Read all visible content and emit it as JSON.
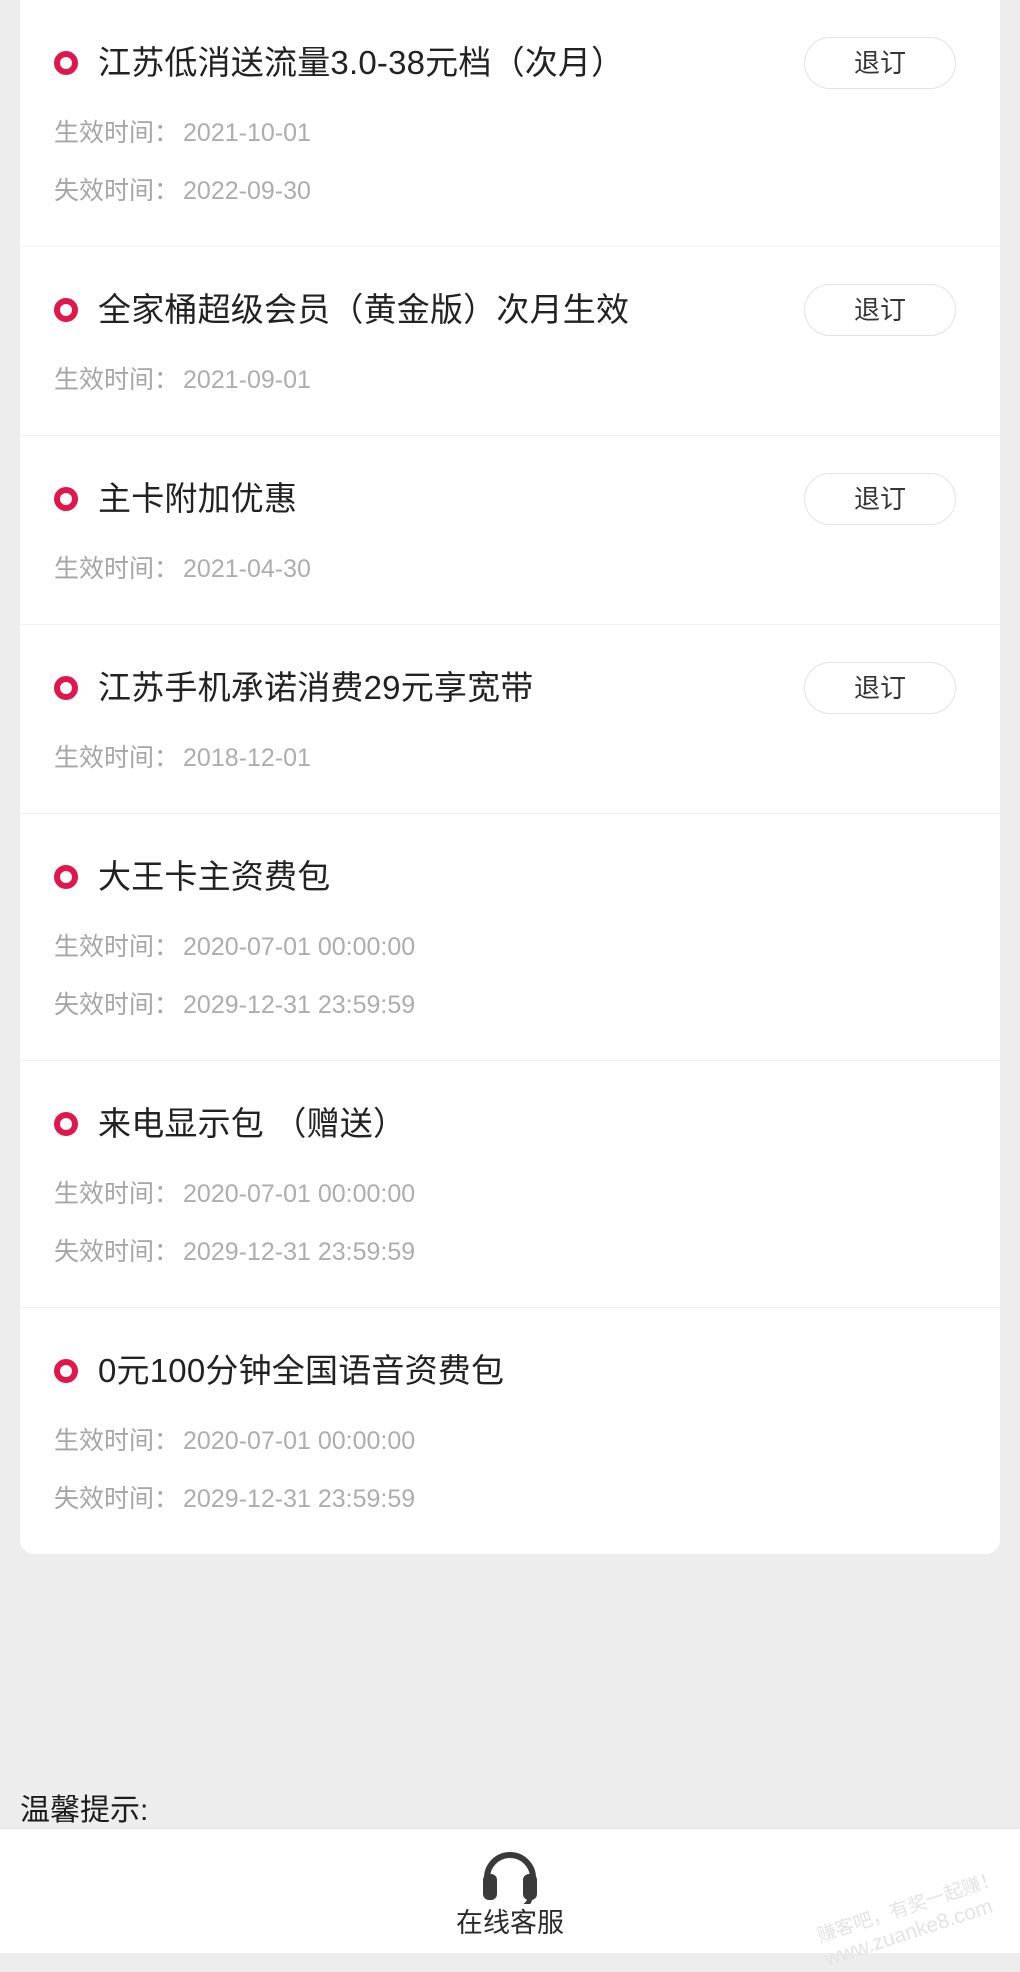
{
  "colors": {
    "page_background": "#ededed",
    "card_background": "#ffffff",
    "bullet_red": "#e1174b",
    "title_text": "#222222",
    "meta_text": "#a6a6a6",
    "button_border": "#e3e3e3"
  },
  "labels": {
    "effective_time": "生效时间：",
    "expiry_time": "失效时间：",
    "unsubscribe": "退订"
  },
  "packages": [
    {
      "name": "江苏低消送流量3.0-38元档（次月）",
      "effective_time": "2021-10-01",
      "expiry_time": "2022-09-30",
      "has_unsubscribe": true,
      "bullet_icon": "red-ring-icon"
    },
    {
      "name": "全家桶超级会员（黄金版）次月生效",
      "effective_time": "2021-09-01",
      "expiry_time": "",
      "has_unsubscribe": true,
      "bullet_icon": "red-ring-icon"
    },
    {
      "name": "主卡附加优惠",
      "effective_time": "2021-04-30",
      "expiry_time": "",
      "has_unsubscribe": true,
      "bullet_icon": "red-ring-icon"
    },
    {
      "name": "江苏手机承诺消费29元享宽带",
      "effective_time": "2018-12-01",
      "expiry_time": "",
      "has_unsubscribe": true,
      "bullet_icon": "red-ring-icon"
    },
    {
      "name": "大王卡主资费包",
      "effective_time": "2020-07-01 00:00:00",
      "expiry_time": "2029-12-31 23:59:59",
      "has_unsubscribe": false,
      "bullet_icon": "red-ring-icon"
    },
    {
      "name": "来电显示包 （赠送）",
      "effective_time": "2020-07-01 00:00:00",
      "expiry_time": "2029-12-31 23:59:59",
      "has_unsubscribe": false,
      "bullet_icon": "red-ring-icon"
    },
    {
      "name": "0元100分钟全国语音资费包",
      "effective_time": "2020-07-01 00:00:00",
      "expiry_time": "2029-12-31 23:59:59",
      "has_unsubscribe": false,
      "bullet_icon": "red-ring-icon"
    }
  ],
  "tips": {
    "title": "温馨提示:"
  },
  "bottom_bar": {
    "service_label": "在线客服",
    "service_icon": "headset-icon"
  },
  "watermark": {
    "line1": "赚客吧，有奖一起赚！",
    "line2": "www.zuanke8.com"
  }
}
